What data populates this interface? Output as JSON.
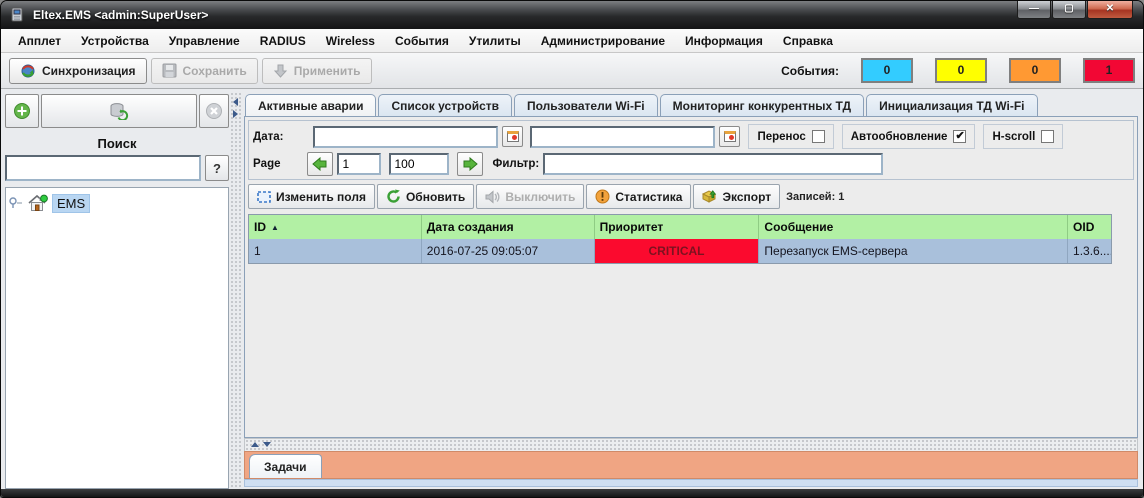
{
  "window": {
    "title": "Eltex.EMS <admin:SuperUser>"
  },
  "menu": {
    "items": [
      "Апплет",
      "Устройства",
      "Управление",
      "RADIUS",
      "Wireless",
      "События",
      "Утилиты",
      "Администрирование",
      "Информация",
      "Справка"
    ]
  },
  "toolbar": {
    "sync_label": "Синхронизация",
    "save_label": "Сохранить",
    "apply_label": "Применить",
    "events_label": "События:",
    "counters": [
      {
        "name": "info",
        "value": "0",
        "color": "#33ccff"
      },
      {
        "name": "warning",
        "value": "0",
        "color": "#ffff00"
      },
      {
        "name": "major",
        "value": "0",
        "color": "#ff9933"
      },
      {
        "name": "critical",
        "value": "1",
        "color": "#f20734"
      }
    ]
  },
  "sidebar": {
    "search_label": "Поиск",
    "search_value": "",
    "help_button_label": "?",
    "tree": {
      "root_label": "EMS"
    }
  },
  "main": {
    "tabs": [
      {
        "label": "Активные аварии"
      },
      {
        "label": "Список устройств"
      },
      {
        "label": "Пользователи Wi-Fi"
      },
      {
        "label": "Мониторинг конкурентных ТД"
      },
      {
        "label": "Инициализация ТД Wi-Fi"
      }
    ],
    "filters": {
      "date_label": "Дата:",
      "date_from": "",
      "date_to": "",
      "wrap_label": "Перенос",
      "wrap_checked": false,
      "autorefresh_label": "Автообновление",
      "autorefresh_checked": true,
      "hscroll_label": "H-scroll",
      "hscroll_checked": false
    },
    "pager": {
      "page_label": "Page",
      "page_value": "1",
      "page_size_value": "100",
      "filter_label": "Фильтр:",
      "filter_value": ""
    },
    "actions": {
      "edit_fields_label": "Изменить поля",
      "refresh_label": "Обновить",
      "mute_label": "Выключить",
      "statistics_label": "Статистика",
      "export_label": "Экспорт",
      "records_label": "Записей: 1"
    },
    "table": {
      "columns": [
        "ID",
        "Дата создания",
        "Приоритет",
        "Сообщение",
        "OID"
      ],
      "sort_icon": "▲",
      "header_bg": "#b2f0a4",
      "row_bg": "#a9c0db",
      "rows": [
        {
          "id": "1",
          "created": "2016-07-25 09:05:07",
          "priority": "CRITICAL",
          "priority_bg": "#fb0a2e",
          "priority_fg": "#7c1220",
          "message": "Перезапуск EMS-сервера",
          "oid": "1.3.6...."
        }
      ]
    },
    "tasks_tab_label": "Задачи"
  }
}
